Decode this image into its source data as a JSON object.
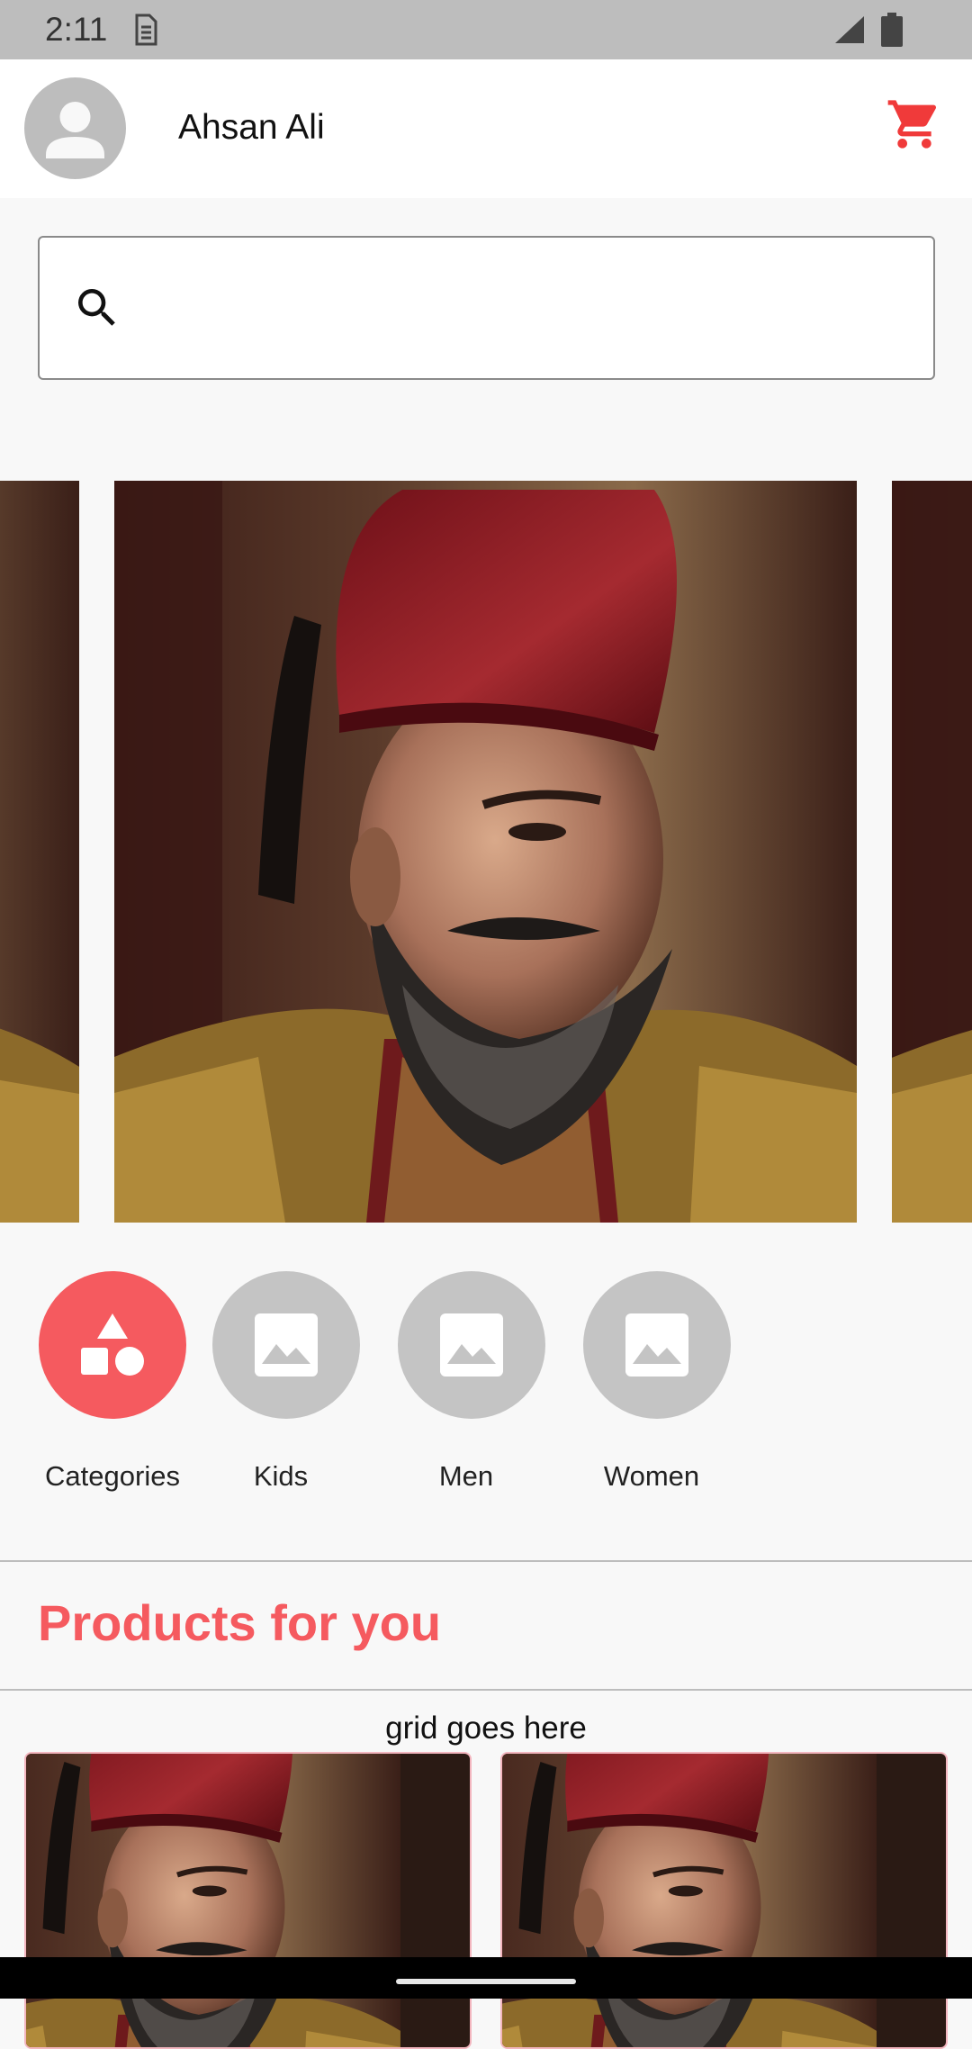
{
  "status_bar": {
    "time": "2:11"
  },
  "header": {
    "username": "Ahsan Ali"
  },
  "search": {
    "placeholder": ""
  },
  "categories": [
    {
      "label": "Categories",
      "icon": "shapes-icon",
      "active": true
    },
    {
      "label": "Kids",
      "icon": "image-placeholder-icon",
      "active": false
    },
    {
      "label": "Men",
      "icon": "image-placeholder-icon",
      "active": false
    },
    {
      "label": "Women",
      "icon": "image-placeholder-icon",
      "active": false
    }
  ],
  "products": {
    "title": "Products for you",
    "grid_placeholder": "grid goes here"
  },
  "colors": {
    "accent": "#f55a5f",
    "cart": "#f03a3a"
  }
}
